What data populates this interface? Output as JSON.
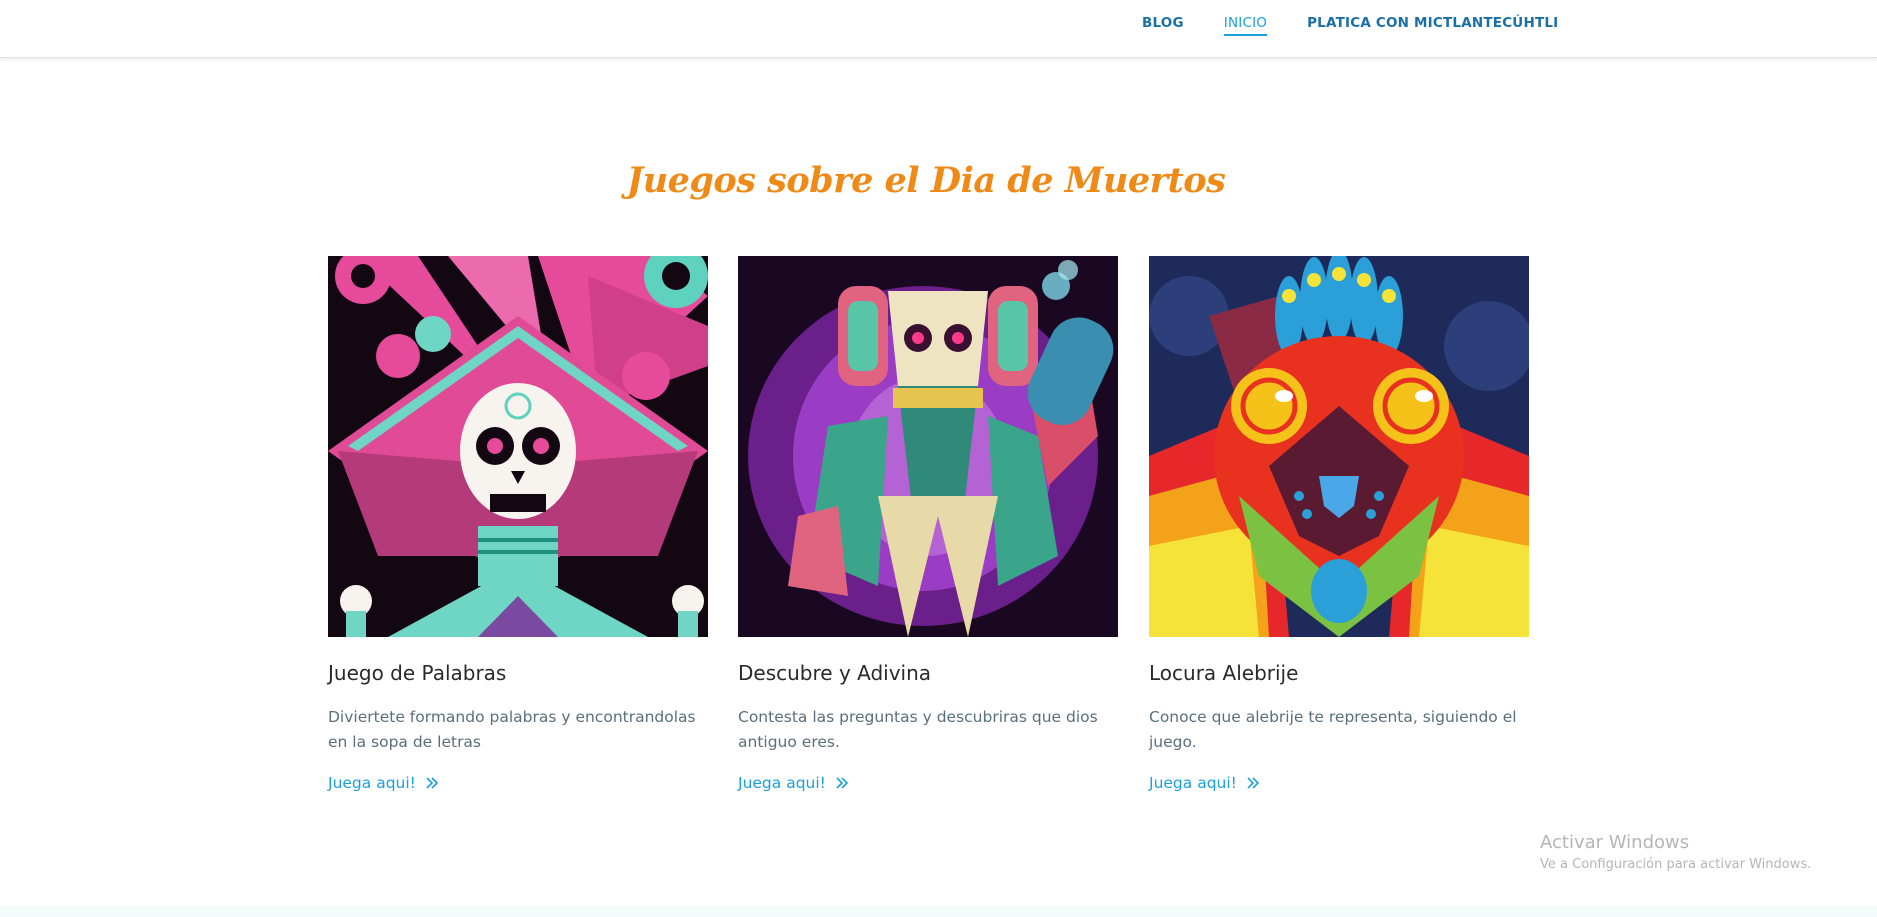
{
  "nav": {
    "items": [
      {
        "label": "BLOG",
        "active": false
      },
      {
        "label": "INICIO",
        "active": true
      },
      {
        "label": "PLATICA CON MICTLANTECÚHTLI",
        "active": false
      }
    ]
  },
  "section": {
    "title": "Juegos sobre el Dia de Muertos"
  },
  "cards": [
    {
      "title": "Juego de Palabras",
      "description": "Diviertete formando palabras y encontrandolas en la sopa de letras",
      "link": "Juega aqui!",
      "image": "calavera-catrina-illustration"
    },
    {
      "title": "Descubre y Adivina",
      "description": "Contesta las preguntas y descubriras que dios antiguo eres.",
      "link": "Juega aqui!",
      "image": "mictlantecuhtli-god-illustration"
    },
    {
      "title": "Locura Alebrije",
      "description": "Conoce que alebrije te representa, siguiendo el juego.",
      "link": "Juega aqui!",
      "image": "alebrije-creature-illustration"
    }
  ],
  "watermark": {
    "line1": "Activar Windows",
    "line2": "Ve a Configuración para activar Windows."
  },
  "colors": {
    "title": "#ef8a17",
    "nav": "#1a6fa8",
    "link": "#1aa0dd",
    "text": "#5a6f7c"
  }
}
